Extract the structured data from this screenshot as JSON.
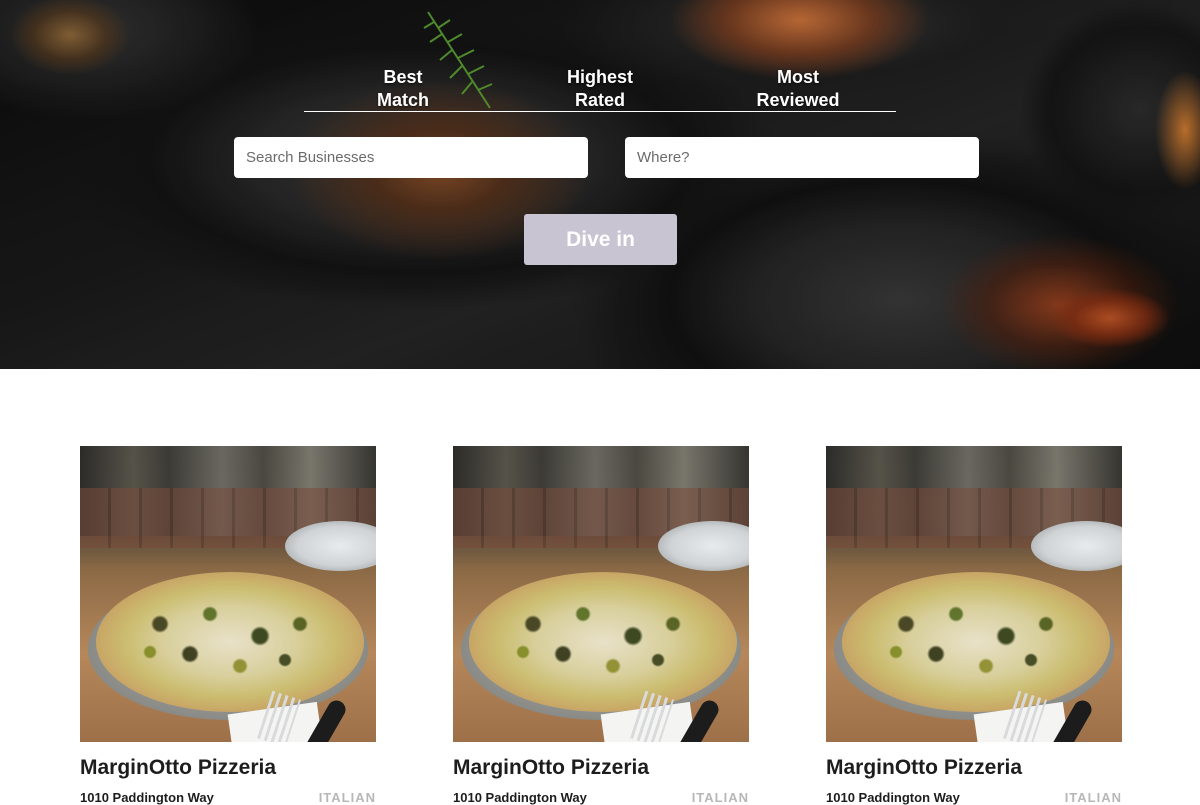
{
  "hero": {
    "tabs": [
      {
        "line1": "Best",
        "line2": "Match"
      },
      {
        "line1": "Highest",
        "line2": "Rated"
      },
      {
        "line1": "Most",
        "line2": "Reviewed"
      }
    ],
    "search_placeholder": "Search Businesses",
    "location_placeholder": "Where?",
    "submit_label": "Dive in"
  },
  "results": [
    {
      "name": "MarginOtto Pizzeria",
      "address": "1010 Paddington Way",
      "category": "ITALIAN"
    },
    {
      "name": "MarginOtto Pizzeria",
      "address": "1010 Paddington Way",
      "category": "ITALIAN"
    },
    {
      "name": "MarginOtto Pizzeria",
      "address": "1010 Paddington Way",
      "category": "ITALIAN"
    }
  ],
  "colors": {
    "button_bg": "#c9c4d1",
    "text_dark": "#1d1d1d",
    "category_gray": "#b7b7b7"
  }
}
